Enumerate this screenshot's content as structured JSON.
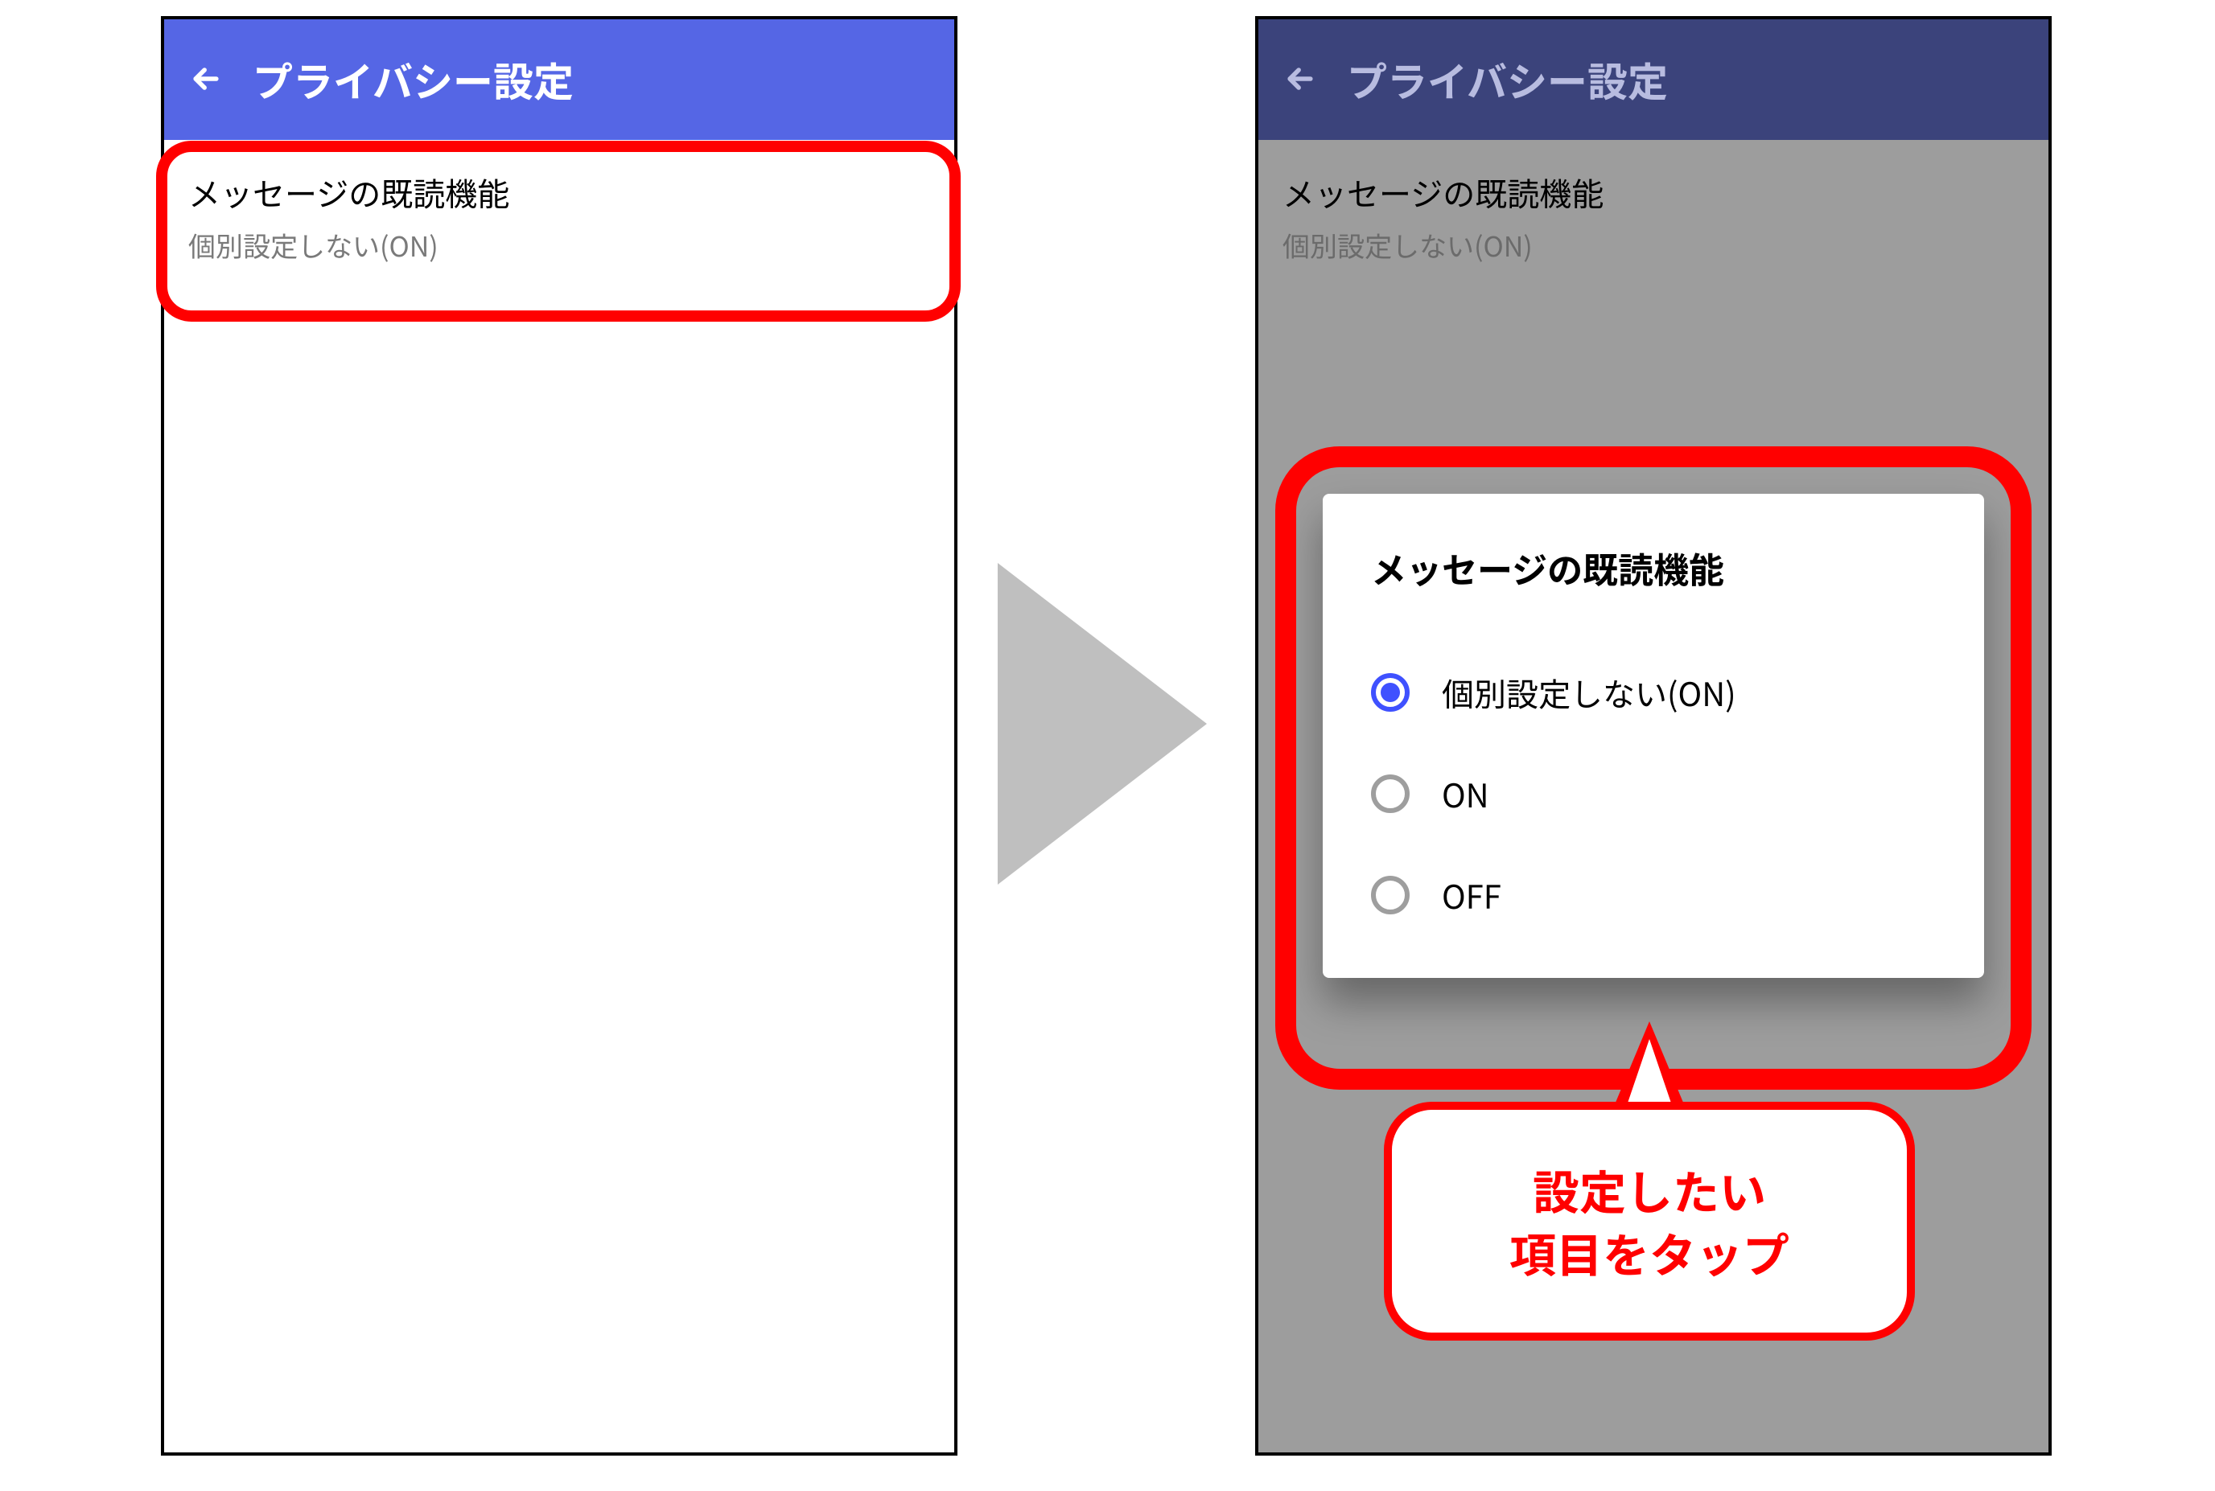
{
  "left": {
    "appbar_title": "プライバシー設定",
    "row": {
      "title": "メッセージの既読機能",
      "subtitle": "個別設定しない(ON)"
    }
  },
  "right": {
    "appbar_title": "プライバシー設定",
    "row": {
      "title": "メッセージの既読機能",
      "subtitle": "個別設定しない(ON)"
    },
    "dialog": {
      "title": "メッセージの既読機能",
      "options": [
        {
          "label": "個別設定しない(ON)",
          "selected": true
        },
        {
          "label": "ON",
          "selected": false
        },
        {
          "label": "OFF",
          "selected": false
        }
      ]
    }
  },
  "callout": {
    "line1": "設定したい",
    "line2": "項目をタップ"
  }
}
